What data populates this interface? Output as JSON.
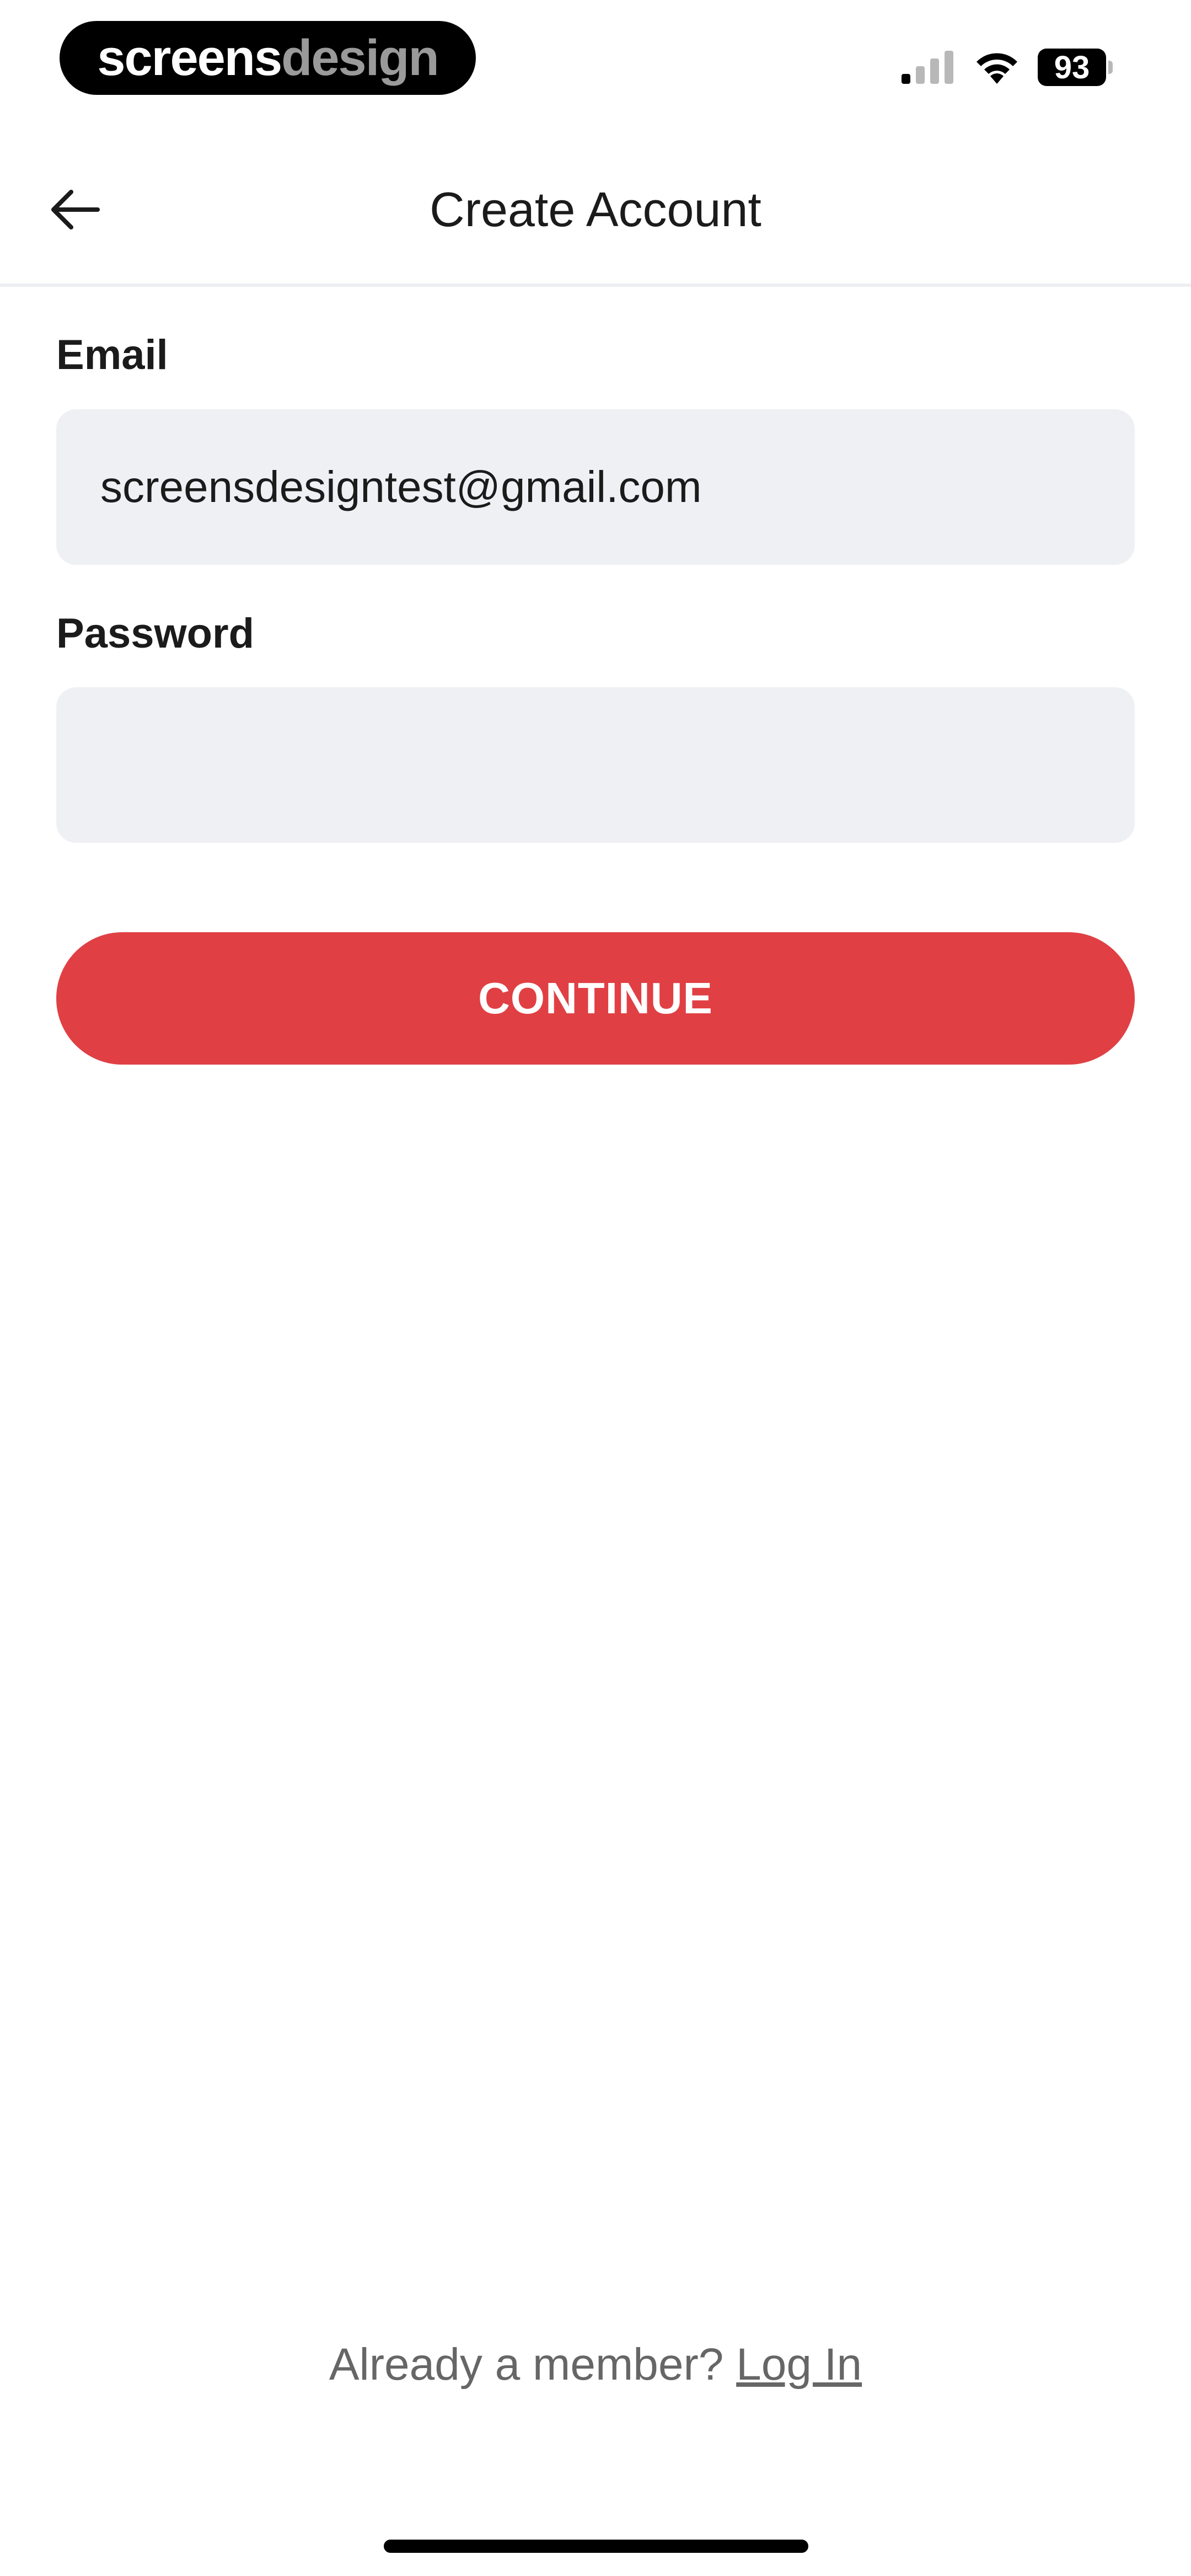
{
  "status_bar": {
    "brand_part1": "screens",
    "brand_part2": "design",
    "battery_level": "93"
  },
  "nav": {
    "title": "Create Account"
  },
  "form": {
    "email_label": "Email",
    "email_value": "screensdesigntest@gmail.com",
    "password_label": "Password",
    "password_value": "",
    "continue_label": "CONTINUE"
  },
  "footer": {
    "prompt": "Already a member?",
    "login_label": "Log In"
  },
  "colors": {
    "accent": "#e04044",
    "field_bg": "#eff0f4",
    "muted_text": "#666666"
  }
}
